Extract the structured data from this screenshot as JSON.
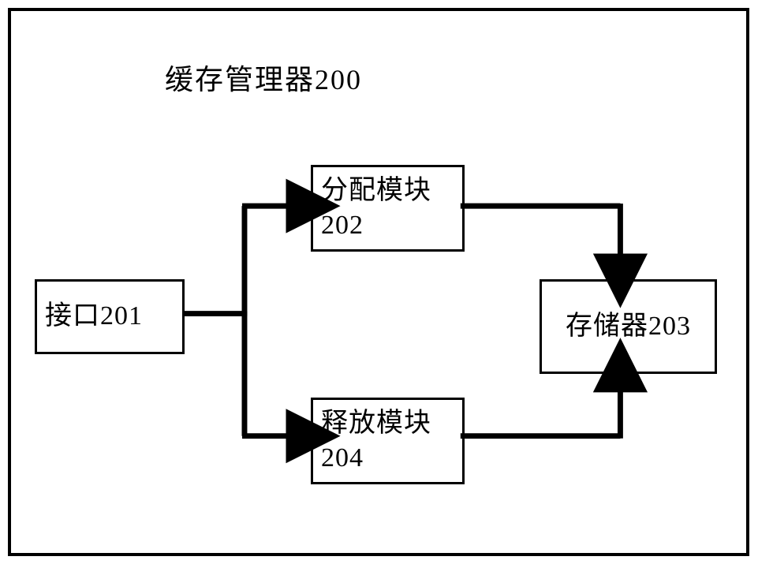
{
  "title": "缓存管理器200",
  "blocks": {
    "interface": {
      "label": "接口201"
    },
    "alloc": {
      "line1": "分配模块",
      "line2": "202"
    },
    "release": {
      "line1": "释放模块",
      "line2": "204"
    },
    "storage": {
      "label": "存储器203"
    }
  }
}
